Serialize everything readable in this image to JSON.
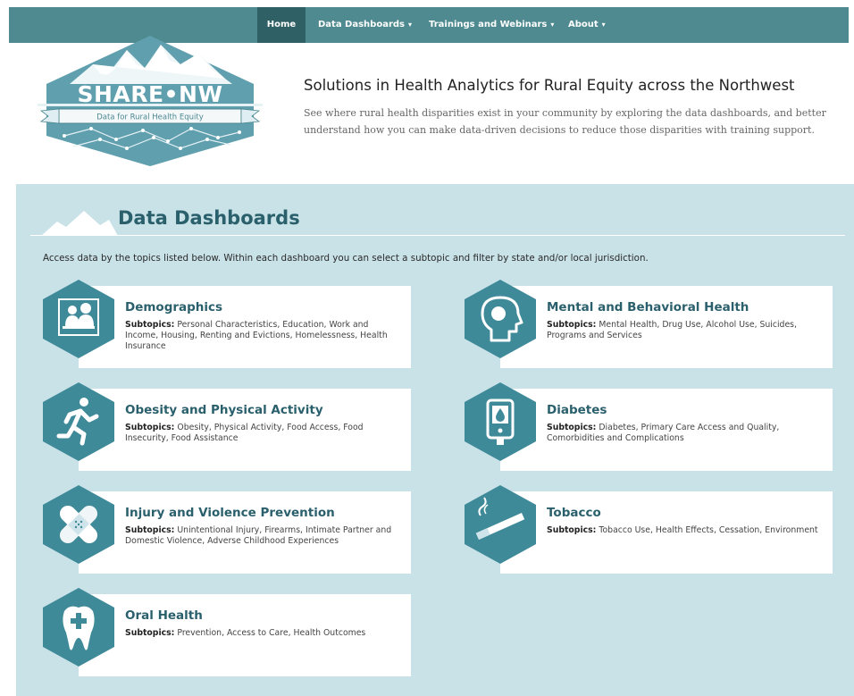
{
  "nav": {
    "items": [
      {
        "label": "Home",
        "caret": ""
      },
      {
        "label": "Data Dashboards",
        "caret": "▾"
      },
      {
        "label": "Trainings and Webinars",
        "caret": "▾"
      },
      {
        "label": "About",
        "caret": "▾"
      }
    ]
  },
  "logo": {
    "title": "SHARE•NW",
    "subtitle": "Data for Rural Health Equity"
  },
  "header": {
    "title": "Solutions in Health Analytics for Rural Equity across the Northwest",
    "description": "See where rural health disparities exist in your community by exploring the data dashboards, and better understand how you can make data-driven decisions to reduce those disparities with training support."
  },
  "section": {
    "title": "Data Dashboards",
    "intro": "Access data by the topics listed below. Within each dashboard you can select a subtopic and filter by state and/or local jurisdiction."
  },
  "subtopics_label": "Subtopics:",
  "colors": {
    "nav": "#4f8a90",
    "nav_active": "#2f6066",
    "section_bg": "#c9e2e8",
    "hexagon": "#3f8a99",
    "title": "#2a5f6c"
  },
  "cards": [
    {
      "title": "Demographics",
      "icon": "family-icon",
      "subtopics": "Personal Characteristics, Education, Work and Income, Housing, Renting and Evictions, Homelessness, Health Insurance"
    },
    {
      "title": "Mental and Behavioral Health",
      "icon": "head-profile-icon",
      "subtopics": "Mental Health, Drug Use, Alcohol Use, Suicides, Programs and Services"
    },
    {
      "title": "Obesity and Physical Activity",
      "icon": "runner-icon",
      "subtopics": "Obesity, Physical Activity, Food Access, Food Insecurity, Food Assistance"
    },
    {
      "title": "Diabetes",
      "icon": "glucose-meter-icon",
      "subtopics": "Diabetes, Primary Care Access and Quality, Comorbidities and Complications"
    },
    {
      "title": "Injury and Violence Prevention",
      "icon": "bandage-icon",
      "subtopics": "Unintentional Injury, Firearms, Intimate Partner and Domestic Violence, Adverse Childhood Experiences"
    },
    {
      "title": "Tobacco",
      "icon": "cigarette-icon",
      "subtopics": "Tobacco Use, Health Effects, Cessation, Environment"
    },
    {
      "title": "Oral Health",
      "icon": "tooth-icon",
      "subtopics": "Prevention, Access to Care, Health Outcomes"
    }
  ]
}
